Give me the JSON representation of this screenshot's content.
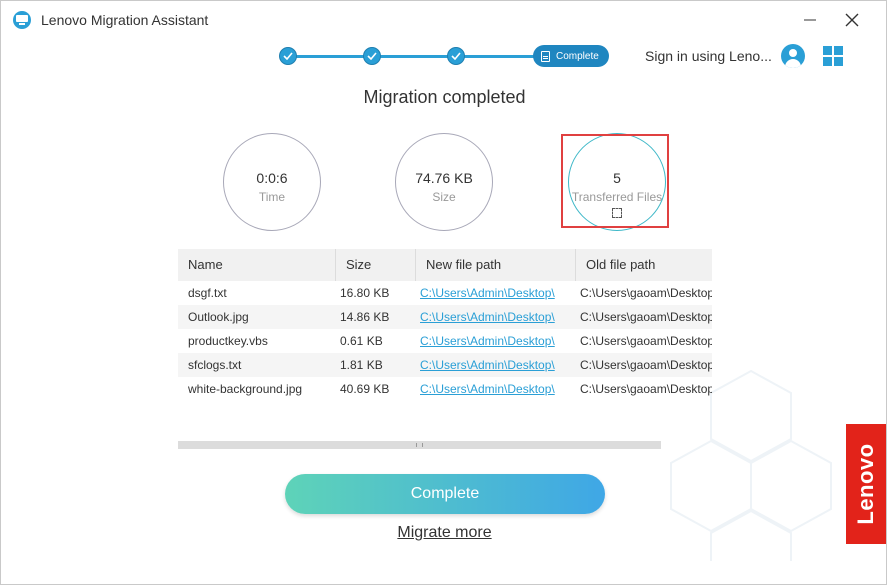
{
  "window": {
    "title": "Lenovo Migration Assistant"
  },
  "stepper": {
    "current_step_label": "Complete"
  },
  "header": {
    "signin_label": "Sign in using Leno..."
  },
  "heading": "Migration completed",
  "stats": {
    "time": {
      "value": "0:0:6",
      "label": "Time"
    },
    "size": {
      "value": "74.76 KB",
      "label": "Size"
    },
    "files": {
      "value": "5",
      "label": "Transferred Files"
    }
  },
  "table": {
    "columns": [
      "Name",
      "Size",
      "New file path",
      "Old file path"
    ],
    "rows": [
      {
        "name": "dsgf.txt",
        "size": "16.80 KB",
        "new_path": "C:\\Users\\Admin\\Desktop\\",
        "old_path": "C:\\Users\\gaoam\\Desktop"
      },
      {
        "name": "Outlook.jpg",
        "size": "14.86 KB",
        "new_path": "C:\\Users\\Admin\\Desktop\\",
        "old_path": "C:\\Users\\gaoam\\Desktop"
      },
      {
        "name": "productkey.vbs",
        "size": "0.61 KB",
        "new_path": "C:\\Users\\Admin\\Desktop\\",
        "old_path": "C:\\Users\\gaoam\\Desktop"
      },
      {
        "name": "sfclogs.txt",
        "size": "1.81 KB",
        "new_path": "C:\\Users\\Admin\\Desktop\\",
        "old_path": "C:\\Users\\gaoam\\Desktop"
      },
      {
        "name": "white-background.jpg",
        "size": "40.69 KB",
        "new_path": "C:\\Users\\Admin\\Desktop\\",
        "old_path": "C:\\Users\\gaoam\\Desktop"
      }
    ]
  },
  "buttons": {
    "complete_label": "Complete",
    "migrate_more_label": "Migrate more"
  },
  "brand": {
    "logo_text": "Lenovo"
  },
  "colors": {
    "accent": "#2a9fd6",
    "brand_red": "#e2231a",
    "highlight": "#e04040"
  }
}
